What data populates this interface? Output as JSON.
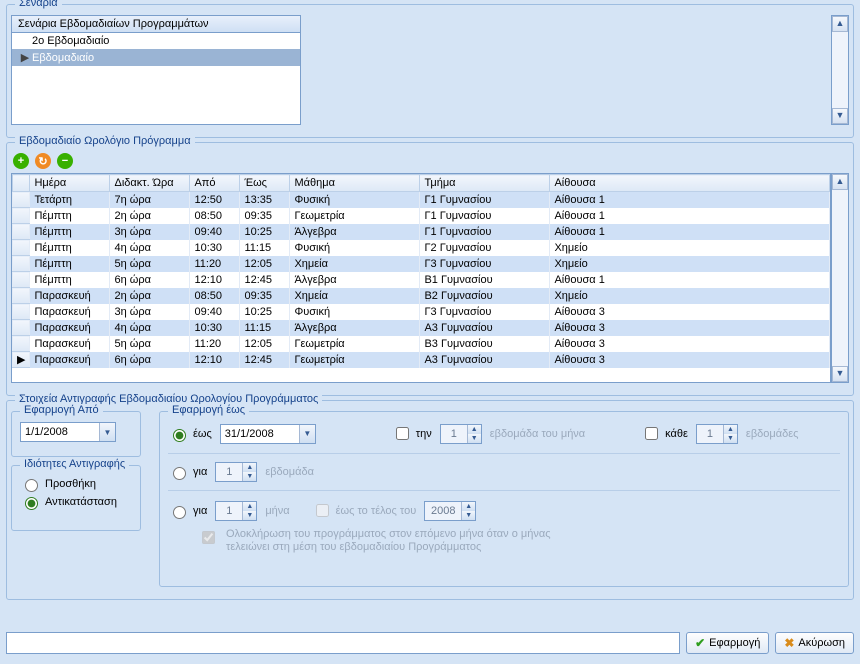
{
  "scenarios": {
    "legend": "Σενάρια",
    "header": "Σενάρια Εβδομαδιαίων Προγραμμάτων",
    "rows": [
      "2ο Εβδομαδιαίο",
      "Εβδομαδιαίο"
    ],
    "selected_index": 1
  },
  "schedule": {
    "legend": "Εβδομαδιαίο Ωρολόγιο Πρόγραμμα",
    "columns": [
      "Ημέρα",
      "Διδακτ. Ώρα",
      "Από",
      "Έως",
      "Μάθημα",
      "Τμήμα",
      "Αίθουσα"
    ],
    "rows": [
      [
        "Τετάρτη",
        "7η ώρα",
        "12:50",
        "13:35",
        "Φυσική",
        "Γ1 Γυμνασίου",
        "Αίθουσα 1"
      ],
      [
        "Πέμπτη",
        "2η ώρα",
        "08:50",
        "09:35",
        "Γεωμετρία",
        "Γ1 Γυμνασίου",
        "Αίθουσα 1"
      ],
      [
        "Πέμπτη",
        "3η ώρα",
        "09:40",
        "10:25",
        "Άλγεβρα",
        "Γ1 Γυμνασίου",
        "Αίθουσα 1"
      ],
      [
        "Πέμπτη",
        "4η ώρα",
        "10:30",
        "11:15",
        "Φυσική",
        "Γ2 Γυμνασίου",
        "Χημείο"
      ],
      [
        "Πέμπτη",
        "5η ώρα",
        "11:20",
        "12:05",
        "Χημεία",
        "Γ3 Γυμνασίου",
        "Χημείο"
      ],
      [
        "Πέμπτη",
        "6η ώρα",
        "12:10",
        "12:45",
        "Άλγεβρα",
        "Β1 Γυμνασίου",
        "Αίθουσα 1"
      ],
      [
        "Παρασκευή",
        "2η ώρα",
        "08:50",
        "09:35",
        "Χημεία",
        "Β2 Γυμνασίου",
        "Χημείο"
      ],
      [
        "Παρασκευή",
        "3η ώρα",
        "09:40",
        "10:25",
        "Φυσική",
        "Γ3 Γυμνασίου",
        "Αίθουσα 3"
      ],
      [
        "Παρασκευή",
        "4η ώρα",
        "10:30",
        "11:15",
        "Άλγεβρα",
        "Α3 Γυμνασίου",
        "Αίθουσα 3"
      ],
      [
        "Παρασκευή",
        "5η ώρα",
        "11:20",
        "12:05",
        "Γεωμετρία",
        "Β3 Γυμνασίου",
        "Αίθουσα 3"
      ],
      [
        "Παρασκευή",
        "6η ώρα",
        "12:10",
        "12:45",
        "Γεωμετρία",
        "Α3 Γυμνασίου",
        "Αίθουσα 3"
      ]
    ],
    "current_row_index": 10
  },
  "copy": {
    "legend": "Στοιχεία Αντιγραφής Εβδομαδιαίου Ωρολογίου Προγράμματος",
    "from_legend": "Εφαρμογή Από",
    "from_date": "1/1/2008",
    "props_legend": "Ιδιότητες Αντιγραφής",
    "opt_add": "Προσθήκη",
    "opt_replace": "Αντικατάσταση",
    "to_legend": "Εφαρμογή έως",
    "radio_until": "έως",
    "to_date": "31/1/2008",
    "chk_the": "την",
    "week_of_month_val": "1",
    "week_of_month_label": "εβδομάδα του μήνα",
    "chk_every": "κάθε",
    "every_val": "1",
    "every_label": "εβδομάδες",
    "radio_for1": "για",
    "for_weeks_val": "1",
    "for_weeks_label": "εβδομάδα",
    "radio_for2": "για",
    "for_months_val": "1",
    "for_months_label": "μήνα",
    "until_end_label": "έως το τέλος του",
    "until_end_year": "2008",
    "complete_month_note": "Ολοκλήρωση του προγράμματος στον επόμενο μήνα όταν ο μήνας τελειώνει στη μέση του εβδομαδιαίου Προγράμματος"
  },
  "buttons": {
    "apply": "Εφαρμογή",
    "cancel": "Ακύρωση"
  }
}
